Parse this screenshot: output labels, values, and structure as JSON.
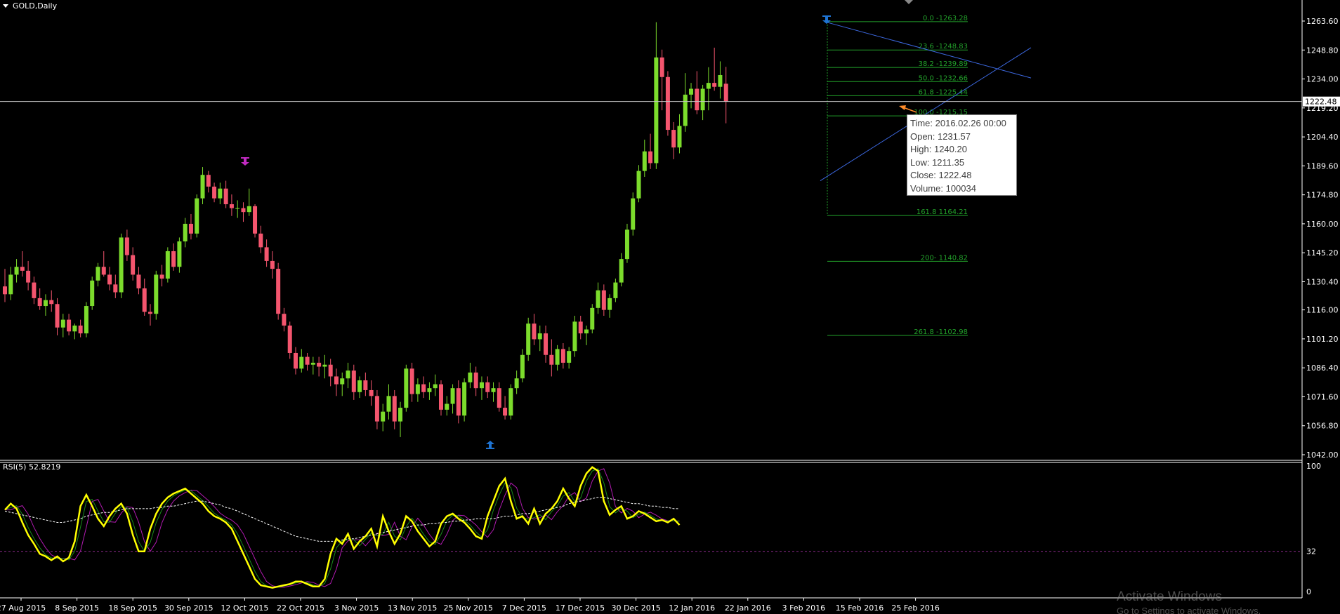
{
  "header": {
    "symbol_label": "GOLD,Daily"
  },
  "indicator": {
    "label": "RSI(5) 52.8219"
  },
  "tooltip": {
    "time": "Time: 2016.02.26 00:00",
    "open": "Open: 1231.57",
    "high": "High: 1240.20",
    "low": "Low:  1211.35",
    "close": "Close: 1222.48",
    "volume": "Volume: 100034"
  },
  "current_price_label": "1222.48",
  "watermark": {
    "title": "Activate Windows",
    "subtitle": "Go to Settings to activate Windows."
  },
  "colors": {
    "background": "#000000",
    "bull_candle": "#7cdc2c",
    "bear_candle": "#f4556e",
    "fib_lines": "#22a02a",
    "trend_lines": "#3c68e0",
    "rsi_main": "#ffff00",
    "rsi_signal_green": "#1a8a1a",
    "rsi_signal_magenta": "#b01ab0",
    "rsi_ma": "#ffffff",
    "level_line": "#8a2a8a",
    "arrow_up": "#1e73d2",
    "arrow_down_magenta": "#c02ac0",
    "tooltip_arrow": "#ff8c2a"
  },
  "chart_data": [
    {
      "type": "candlestick",
      "title": "GOLD,Daily",
      "x": [
        "27 Aug 2015",
        "8 Sep 2015",
        "18 Sep 2015",
        "30 Sep 2015",
        "12 Oct 2015",
        "22 Oct 2015",
        "3 Nov 2015",
        "13 Nov 2015",
        "25 Nov 2015",
        "7 Dec 2015",
        "17 Dec 2015",
        "30 Dec 2015",
        "12 Jan 2016",
        "22 Jan 2016",
        "3 Feb 2016",
        "15 Feb 2016",
        "25 Feb 2016"
      ],
      "y_ticks": [
        "1263.60",
        "1248.80",
        "1234.00",
        "1219.20",
        "1204.40",
        "1189.60",
        "1174.80",
        "1160.00",
        "1145.20",
        "1130.40",
        "1116.00",
        "1101.20",
        "1086.40",
        "1071.60",
        "1056.80",
        "1042.00"
      ],
      "ylim": [
        1042.0,
        1273.0
      ],
      "candles": [
        [
          1128,
          1137,
          1120,
          1124
        ],
        [
          1124,
          1138,
          1121,
          1134
        ],
        [
          1134,
          1142,
          1130,
          1138
        ],
        [
          1138,
          1146,
          1133,
          1136
        ],
        [
          1136,
          1141,
          1126,
          1130
        ],
        [
          1130,
          1133,
          1119,
          1122
        ],
        [
          1122,
          1127,
          1116,
          1118
        ],
        [
          1118,
          1124,
          1113,
          1121
        ],
        [
          1121,
          1126,
          1115,
          1119
        ],
        [
          1119,
          1122,
          1103,
          1107
        ],
        [
          1107,
          1114,
          1102,
          1111
        ],
        [
          1111,
          1114,
          1103,
          1105
        ],
        [
          1105,
          1109,
          1101,
          1108
        ],
        [
          1108,
          1111,
          1102,
          1104
        ],
        [
          1104,
          1120,
          1102,
          1118
        ],
        [
          1118,
          1133,
          1116,
          1131
        ],
        [
          1131,
          1140,
          1128,
          1138
        ],
        [
          1138,
          1146,
          1133,
          1134
        ],
        [
          1134,
          1138,
          1126,
          1129
        ],
        [
          1129,
          1134,
          1122,
          1125
        ],
        [
          1125,
          1155,
          1122,
          1153
        ],
        [
          1153,
          1157,
          1141,
          1144
        ],
        [
          1144,
          1148,
          1131,
          1134
        ],
        [
          1134,
          1138,
          1124,
          1127
        ],
        [
          1127,
          1132,
          1113,
          1115
        ],
        [
          1115,
          1119,
          1108,
          1114
        ],
        [
          1114,
          1136,
          1111,
          1134
        ],
        [
          1134,
          1139,
          1128,
          1132
        ],
        [
          1132,
          1148,
          1130,
          1146
        ],
        [
          1146,
          1150,
          1136,
          1138
        ],
        [
          1138,
          1153,
          1135,
          1151
        ],
        [
          1151,
          1163,
          1148,
          1160
        ],
        [
          1160,
          1165,
          1152,
          1155
        ],
        [
          1155,
          1175,
          1153,
          1173
        ],
        [
          1173,
          1189,
          1170,
          1185
        ],
        [
          1185,
          1187,
          1176,
          1179
        ],
        [
          1179,
          1181,
          1171,
          1173
        ],
        [
          1173,
          1181,
          1170,
          1178
        ],
        [
          1178,
          1182,
          1168,
          1170
        ],
        [
          1170,
          1175,
          1164,
          1168
        ],
        [
          1168,
          1172,
          1163,
          1168
        ],
        [
          1168,
          1171,
          1161,
          1166
        ],
        [
          1166,
          1178,
          1164,
          1169
        ],
        [
          1169,
          1170,
          1153,
          1155
        ],
        [
          1155,
          1159,
          1145,
          1148
        ],
        [
          1148,
          1152,
          1138,
          1141
        ],
        [
          1141,
          1146,
          1132,
          1137
        ],
        [
          1137,
          1140,
          1111,
          1114
        ],
        [
          1114,
          1117,
          1105,
          1108
        ],
        [
          1108,
          1110,
          1091,
          1094
        ],
        [
          1094,
          1097,
          1083,
          1086
        ],
        [
          1086,
          1096,
          1084,
          1092
        ],
        [
          1092,
          1094,
          1085,
          1088
        ],
        [
          1088,
          1092,
          1083,
          1089
        ],
        [
          1089,
          1092,
          1082,
          1087
        ],
        [
          1087,
          1093,
          1081,
          1088
        ],
        [
          1088,
          1091,
          1077,
          1082
        ],
        [
          1082,
          1086,
          1072,
          1078
        ],
        [
          1078,
          1084,
          1072,
          1081
        ],
        [
          1081,
          1089,
          1076,
          1085
        ],
        [
          1085,
          1088,
          1070,
          1074
        ],
        [
          1074,
          1082,
          1071,
          1080
        ],
        [
          1080,
          1084,
          1072,
          1075
        ],
        [
          1075,
          1080,
          1067,
          1072
        ],
        [
          1072,
          1075,
          1055,
          1059
        ],
        [
          1059,
          1068,
          1054,
          1064
        ],
        [
          1064,
          1078,
          1060,
          1072
        ],
        [
          1072,
          1075,
          1055,
          1059
        ],
        [
          1059,
          1069,
          1051,
          1066
        ],
        [
          1066,
          1088,
          1064,
          1086
        ],
        [
          1086,
          1089,
          1069,
          1073
        ],
        [
          1073,
          1081,
          1069,
          1078
        ],
        [
          1078,
          1082,
          1071,
          1074
        ],
        [
          1074,
          1079,
          1070,
          1076
        ],
        [
          1076,
          1083,
          1072,
          1078
        ],
        [
          1078,
          1080,
          1062,
          1065
        ],
        [
          1065,
          1072,
          1062,
          1068
        ],
        [
          1068,
          1078,
          1063,
          1076
        ],
        [
          1076,
          1080,
          1058,
          1062
        ],
        [
          1062,
          1081,
          1059,
          1079
        ],
        [
          1079,
          1089,
          1076,
          1084
        ],
        [
          1084,
          1087,
          1072,
          1076
        ],
        [
          1076,
          1082,
          1070,
          1079
        ],
        [
          1079,
          1082,
          1071,
          1074
        ],
        [
          1074,
          1079,
          1069,
          1076
        ],
        [
          1076,
          1079,
          1064,
          1066
        ],
        [
          1066,
          1072,
          1060,
          1062
        ],
        [
          1062,
          1078,
          1060,
          1076
        ],
        [
          1076,
          1085,
          1073,
          1081
        ],
        [
          1081,
          1096,
          1079,
          1093
        ],
        [
          1093,
          1112,
          1090,
          1109
        ],
        [
          1109,
          1114,
          1098,
          1101
        ],
        [
          1101,
          1108,
          1095,
          1104
        ],
        [
          1104,
          1108,
          1089,
          1093
        ],
        [
          1093,
          1101,
          1082,
          1088
        ],
        [
          1088,
          1098,
          1085,
          1096
        ],
        [
          1096,
          1099,
          1086,
          1089
        ],
        [
          1089,
          1097,
          1086,
          1095
        ],
        [
          1095,
          1113,
          1092,
          1110
        ],
        [
          1110,
          1113,
          1101,
          1104
        ],
        [
          1104,
          1108,
          1098,
          1106
        ],
        [
          1106,
          1119,
          1104,
          1117
        ],
        [
          1117,
          1130,
          1114,
          1126
        ],
        [
          1126,
          1129,
          1113,
          1116
        ],
        [
          1116,
          1124,
          1112,
          1122
        ],
        [
          1122,
          1132,
          1120,
          1130
        ],
        [
          1130,
          1145,
          1128,
          1142
        ],
        [
          1142,
          1160,
          1140,
          1157
        ],
        [
          1157,
          1176,
          1154,
          1173
        ],
        [
          1173,
          1190,
          1171,
          1187
        ],
        [
          1187,
          1203,
          1184,
          1197
        ],
        [
          1197,
          1206,
          1188,
          1191
        ],
        [
          1191,
          1263,
          1188,
          1245
        ],
        [
          1245,
          1249,
          1218,
          1235
        ],
        [
          1235,
          1238,
          1205,
          1208
        ],
        [
          1208,
          1212,
          1193,
          1199
        ],
        [
          1199,
          1216,
          1196,
          1210
        ],
        [
          1210,
          1237,
          1207,
          1226
        ],
        [
          1226,
          1232,
          1219,
          1229
        ],
        [
          1229,
          1238,
          1216,
          1218
        ],
        [
          1218,
          1231,
          1213,
          1229
        ],
        [
          1229,
          1240,
          1218,
          1232
        ],
        [
          1232,
          1250,
          1228,
          1230
        ],
        [
          1230,
          1243,
          1224,
          1236
        ],
        [
          1231.57,
          1240.2,
          1211.35,
          1222.48
        ]
      ],
      "fibonacci_levels": [
        {
          "label": "0.0 -1263.28",
          "value": 1263.28
        },
        {
          "label": "23.6 -1248.83",
          "value": 1248.83
        },
        {
          "label": "38.2 -1239.89",
          "value": 1239.89
        },
        {
          "label": "50.0 -1232.66",
          "value": 1232.66
        },
        {
          "label": "61.8 -1225.44",
          "value": 1225.44
        },
        {
          "label": "100.0 -1215.15",
          "value": 1215.15
        },
        {
          "label": "161.8 1164.21",
          "value": 1164.21
        },
        {
          "label": "200- 1140.82",
          "value": 1140.82
        },
        {
          "label": "261.8 -1102.98",
          "value": 1102.98
        }
      ],
      "current_price": 1222.48
    },
    {
      "type": "line",
      "title": "RSI(5) 52.8219",
      "y_ticks": [
        "100",
        "32",
        "0"
      ],
      "ylim": [
        0,
        100
      ],
      "levels": [
        32
      ],
      "series": [
        {
          "values": [
            65,
            70,
            66,
            55,
            45,
            38,
            30,
            28,
            25,
            28,
            24,
            27,
            40,
            68,
            77,
            68,
            58,
            52,
            60,
            66,
            70,
            62,
            45,
            32,
            32,
            50,
            62,
            70,
            75,
            78,
            80,
            82,
            78,
            74,
            70,
            64,
            60,
            58,
            55,
            50,
            40,
            30,
            20,
            10,
            5,
            4,
            3,
            4,
            5,
            6,
            8,
            8,
            6,
            4,
            4,
            10,
            30,
            42,
            38,
            46,
            34,
            40,
            44,
            50,
            36,
            60,
            48,
            38,
            46,
            60,
            56,
            48,
            42,
            36,
            40,
            54,
            60,
            62,
            58,
            55,
            50,
            44,
            42,
            60,
            72,
            84,
            90,
            72,
            58,
            60,
            54,
            66,
            54,
            62,
            66,
            72,
            82,
            74,
            68,
            84,
            94,
            99,
            96,
            72,
            61,
            65,
            68,
            58,
            60,
            64,
            62,
            59,
            56,
            57,
            55,
            58,
            53
          ]
        }
      ],
      "ma_series": [
        64,
        63,
        62,
        61,
        60,
        59,
        58,
        57,
        56,
        55,
        55,
        56,
        57,
        58,
        60,
        61,
        62,
        63,
        63,
        64,
        65,
        66,
        66,
        66,
        66,
        66,
        67,
        67,
        68,
        68,
        69,
        70,
        71,
        72,
        72,
        71,
        70,
        69,
        67,
        66,
        64,
        62,
        60,
        58,
        56,
        54,
        52,
        50,
        48,
        46,
        44,
        43,
        42,
        41,
        40,
        40,
        40,
        40,
        41,
        42,
        42,
        43,
        44,
        45,
        46,
        47,
        48,
        49,
        50,
        51,
        52,
        53,
        53,
        54,
        54,
        55,
        55,
        56,
        56,
        57,
        57,
        58,
        58,
        58,
        58,
        59,
        60,
        60,
        61,
        62,
        62,
        63,
        64,
        65,
        66,
        67,
        68,
        70,
        71,
        72,
        73,
        74,
        75,
        75,
        74,
        73,
        72,
        71,
        70,
        70,
        69,
        68,
        68,
        67,
        67,
        66,
        66
      ]
    }
  ]
}
